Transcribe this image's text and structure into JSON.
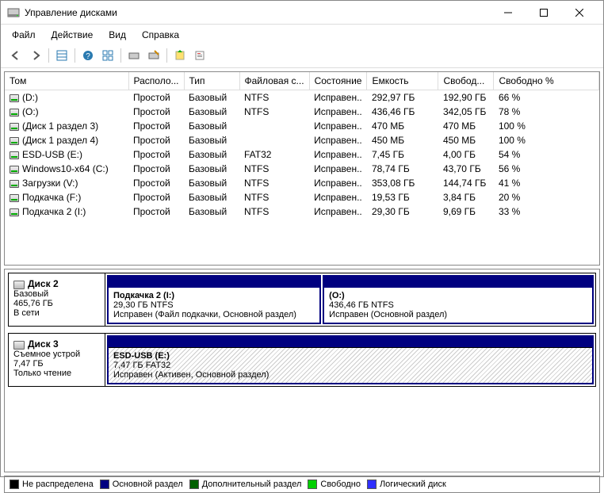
{
  "window": {
    "title": "Управление дисками"
  },
  "menu": {
    "file": "Файл",
    "action": "Действие",
    "view": "Вид",
    "help": "Справка"
  },
  "columns": {
    "volume": "Том",
    "layout": "Располо...",
    "type": "Тип",
    "fs": "Файловая с...",
    "status": "Состояние",
    "capacity": "Емкость",
    "free": "Свобод...",
    "pctfree": "Свободно %"
  },
  "volumes": [
    {
      "name": "(D:)",
      "layout": "Простой",
      "type": "Базовый",
      "fs": "NTFS",
      "status": "Исправен..",
      "capacity": "292,97 ГБ",
      "free": "192,90 ГБ",
      "pct": "66 %"
    },
    {
      "name": "(O:)",
      "layout": "Простой",
      "type": "Базовый",
      "fs": "NTFS",
      "status": "Исправен..",
      "capacity": "436,46 ГБ",
      "free": "342,05 ГБ",
      "pct": "78 %"
    },
    {
      "name": "(Диск 1 раздел 3)",
      "layout": "Простой",
      "type": "Базовый",
      "fs": "",
      "status": "Исправен..",
      "capacity": "470 МБ",
      "free": "470 МБ",
      "pct": "100 %"
    },
    {
      "name": "(Диск 1 раздел 4)",
      "layout": "Простой",
      "type": "Базовый",
      "fs": "",
      "status": "Исправен..",
      "capacity": "450 МБ",
      "free": "450 МБ",
      "pct": "100 %"
    },
    {
      "name": "ESD-USB (E:)",
      "layout": "Простой",
      "type": "Базовый",
      "fs": "FAT32",
      "status": "Исправен..",
      "capacity": "7,45 ГБ",
      "free": "4,00 ГБ",
      "pct": "54 %"
    },
    {
      "name": "Windows10-x64 (C:)",
      "layout": "Простой",
      "type": "Базовый",
      "fs": "NTFS",
      "status": "Исправен..",
      "capacity": "78,74 ГБ",
      "free": "43,70 ГБ",
      "pct": "56 %"
    },
    {
      "name": "Загрузки (V:)",
      "layout": "Простой",
      "type": "Базовый",
      "fs": "NTFS",
      "status": "Исправен..",
      "capacity": "353,08 ГБ",
      "free": "144,74 ГБ",
      "pct": "41 %"
    },
    {
      "name": "Подкачка (F:)",
      "layout": "Простой",
      "type": "Базовый",
      "fs": "NTFS",
      "status": "Исправен..",
      "capacity": "19,53 ГБ",
      "free": "3,84 ГБ",
      "pct": "20 %"
    },
    {
      "name": "Подкачка 2 (I:)",
      "layout": "Простой",
      "type": "Базовый",
      "fs": "NTFS",
      "status": "Исправен..",
      "capacity": "29,30 ГБ",
      "free": "9,69 ГБ",
      "pct": "33 %"
    }
  ],
  "disks": {
    "disk2": {
      "name": "Диск 2",
      "type": "Базовый",
      "size": "465,76 ГБ",
      "status": "В сети",
      "p1": {
        "title": "Подкачка 2  (I:)",
        "line2": "29,30 ГБ NTFS",
        "line3": "Исправен (Файл подкачки, Основной раздел)"
      },
      "p2": {
        "title": "(O:)",
        "line2": "436,46 ГБ NTFS",
        "line3": "Исправен (Основной раздел)"
      }
    },
    "disk3": {
      "name": "Диск 3",
      "type": "Съемное устрой",
      "size": "7,47 ГБ",
      "status": "Только чтение",
      "p1": {
        "title": "ESD-USB  (E:)",
        "line2": "7,47 ГБ FAT32",
        "line3": "Исправен (Активен, Основной раздел)"
      }
    }
  },
  "legend": {
    "unalloc": "Не распределена",
    "primary": "Основной раздел",
    "extended": "Дополнительный раздел",
    "free": "Свободно",
    "logical": "Логический диск"
  },
  "colors": {
    "unalloc": "#000000",
    "primary": "#000080",
    "extended": "#006000",
    "free": "#00d000",
    "logical": "#3030ff"
  }
}
